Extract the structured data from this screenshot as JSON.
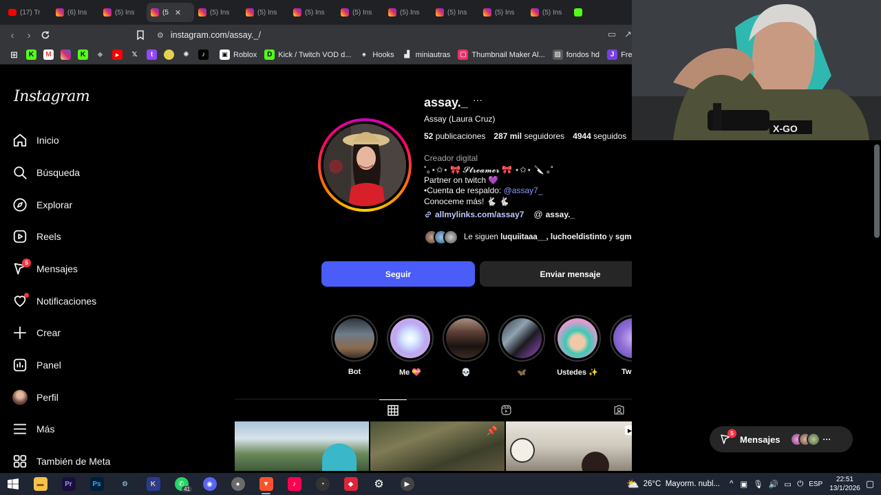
{
  "browser": {
    "tabs": [
      {
        "label": "(17) Tr",
        "icon": "youtube-icon",
        "active": false
      },
      {
        "label": "(6) Ins",
        "icon": "instagram-icon",
        "active": false
      },
      {
        "label": "(5) Ins",
        "icon": "instagram-icon",
        "active": false
      },
      {
        "label": "(5",
        "icon": "instagram-icon",
        "active": true
      },
      {
        "label": "(5) Ins",
        "icon": "instagram-icon",
        "active": false
      },
      {
        "label": "(5) Ins",
        "icon": "instagram-icon",
        "active": false
      },
      {
        "label": "(5) Ins",
        "icon": "instagram-icon",
        "active": false
      },
      {
        "label": "(5) Ins",
        "icon": "instagram-icon",
        "active": false
      },
      {
        "label": "(5) Ins",
        "icon": "instagram-icon",
        "active": false
      },
      {
        "label": "(5) Ins",
        "icon": "instagram-icon",
        "active": false
      },
      {
        "label": "(5) Ins",
        "icon": "instagram-icon",
        "active": false
      },
      {
        "label": "(5) Ins",
        "icon": "instagram-icon",
        "active": false
      },
      {
        "label": "",
        "icon": "kick-icon",
        "active": false
      }
    ],
    "url": "instagram.com/assay._/",
    "bookmarks": [
      {
        "label": "Roblox",
        "icon": "roblox-icon"
      },
      {
        "label": "Kick / Twitch VOD d...",
        "icon": "kick-icon"
      },
      {
        "label": "Hooks",
        "icon": "hooks-icon"
      },
      {
        "label": "miniautras",
        "icon": "chart-icon"
      },
      {
        "label": "Thumbnail Maker Al...",
        "icon": "thumbnail-icon"
      },
      {
        "label": "fondos hd",
        "icon": "image-icon"
      },
      {
        "label": "Free r",
        "icon": "bookmark-icon"
      }
    ]
  },
  "sidebar": {
    "logo": "Instagram",
    "items": [
      {
        "label": "Inicio",
        "icon": "home-icon"
      },
      {
        "label": "Búsqueda",
        "icon": "search-icon"
      },
      {
        "label": "Explorar",
        "icon": "compass-icon"
      },
      {
        "label": "Reels",
        "icon": "reels-icon"
      },
      {
        "label": "Mensajes",
        "icon": "messenger-icon",
        "badge": "5"
      },
      {
        "label": "Notificaciones",
        "icon": "heart-icon"
      },
      {
        "label": "Crear",
        "icon": "plus-icon"
      },
      {
        "label": "Panel",
        "icon": "dashboard-icon"
      },
      {
        "label": "Perfil",
        "icon": "avatar"
      },
      {
        "label": "Más",
        "icon": "menu-icon"
      },
      {
        "label": "También de Meta",
        "icon": "meta-apps-icon"
      }
    ]
  },
  "profile": {
    "username": "assay._",
    "more": "···",
    "full_name": "Assay (Laura Cruz)",
    "stats": {
      "posts_value": "52",
      "posts_label": "publicaciones",
      "followers_value": "287 mil",
      "followers_label": "seguidores",
      "following_value": "4944",
      "following_label": "seguidos"
    },
    "category": "Creador digital",
    "bio": {
      "line1": "˚｡⋆✩⋆ 🎀 𝓢𝓽𝓻𝓮𝓪𝓶𝓮𝓻 🎀 ⋆✩⋆ 🔪 ｡˚",
      "line2": "Partner on twitch 💜",
      "line3_prefix": "•Cuenta de respaldo: ",
      "line3_mention": "@assay7_",
      "line4": "Conoceme más! 🐇 🐇"
    },
    "link": "allmylinks.com/assay7",
    "threads": "assay._",
    "followed_by_prefix": "Le siguen ",
    "followed_by_names": "luquiitaaa__, luchoeldistinto",
    "followed_by_and": " y ",
    "followed_by_last": "sgmarcoo",
    "buttons": {
      "follow": "Seguir",
      "message": "Enviar mensaje"
    },
    "highlights": [
      "Bot",
      "Me 💝",
      "💀",
      "🦋",
      "Ustedes ✨",
      "Twitch",
      "🍂"
    ]
  },
  "floating": {
    "messages_label": "Mensajes",
    "badge": "5"
  },
  "taskbar": {
    "weather": "26°C  Mayorm. nubl...",
    "lang": "ESP",
    "time": "22:51",
    "date": "13/1/2026",
    "whatsapp_badge": "41"
  },
  "colors": {
    "accent": "#4a5df9",
    "badge": "#ff3040",
    "background": "#000000"
  }
}
